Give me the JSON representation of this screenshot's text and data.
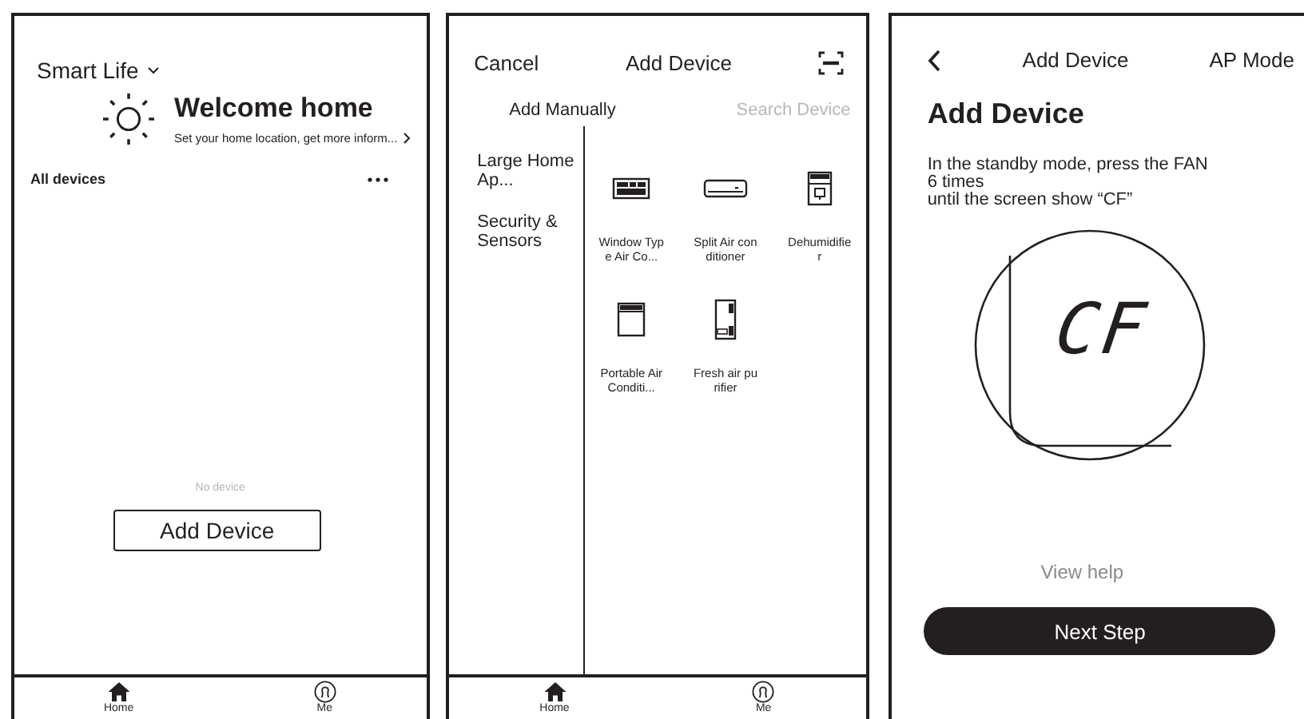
{
  "home_screen": {
    "title": "Smart Life",
    "welcome_title": "Welcome home",
    "welcome_subtitle": "Set your home location, get more inform...",
    "section_title": "All devices",
    "empty_text": "No device",
    "add_button": "Add Device",
    "tab_bar": [
      {
        "label": "Home",
        "kind": "home"
      },
      {
        "label": "Me",
        "kind": "profile"
      }
    ]
  },
  "add_device_screen": {
    "cancel": "Cancel",
    "title": "Add Device",
    "tabs": [
      {
        "label": "Add Manually",
        "selected": true
      },
      {
        "label": "Search Device",
        "selected": false
      }
    ],
    "categories": [
      {
        "label": "Large Home Ap..."
      },
      {
        "label": "Security & Sensors"
      }
    ],
    "devices": [
      {
        "name": "Window Type Air Co...",
        "kind": "window_ac"
      },
      {
        "name": "Split Air conditioner",
        "kind": "split_ac"
      },
      {
        "name": "Dehumidifier",
        "kind": "dehumidifier"
      },
      {
        "name": "Portable Air Conditi...",
        "kind": "portable_ac"
      },
      {
        "name": "Fresh air purifier",
        "kind": "air_purifier"
      }
    ],
    "tab_bar": [
      {
        "label": "Home",
        "kind": "home"
      },
      {
        "label": "Me",
        "kind": "profile"
      }
    ]
  },
  "ap_mode_screen": {
    "nav_title": "Add Device",
    "mode": "AP Mode",
    "heading": "Add Device",
    "instructions": "In the standby mode, press the FAN\n6 times\nuntil the screen show “CF”",
    "display_reading": "CF",
    "help_link": "View help",
    "next_button": "Next Step"
  }
}
